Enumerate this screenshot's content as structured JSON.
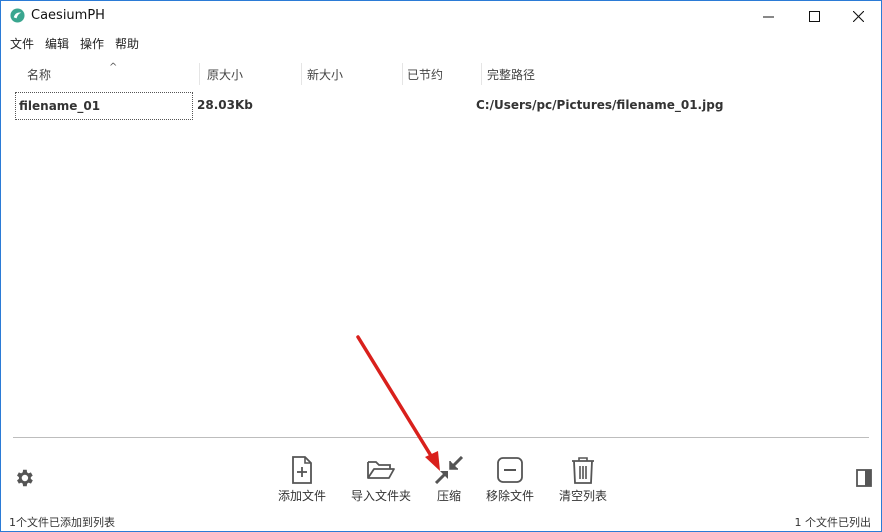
{
  "window": {
    "title": "CaesiumPH",
    "accent": "#2b7bd6"
  },
  "menu": [
    "文件",
    "编辑",
    "操作",
    "帮助"
  ],
  "table": {
    "columns": [
      "名称",
      "原大小",
      "新大小",
      "已节约",
      "完整路径"
    ],
    "rows": [
      {
        "name": "filename_01",
        "original_size": "28.03Kb",
        "new_size": "",
        "saved": "",
        "path": "C:/Users/pc/Pictures/filename_01.jpg"
      }
    ]
  },
  "toolbar": {
    "add_file": "添加文件",
    "import_folder": "导入文件夹",
    "compress": "压缩",
    "remove_file": "移除文件",
    "clear_list": "清空列表"
  },
  "status": {
    "left": "1个文件已添加到列表",
    "right": "1 个文件已列出"
  },
  "annotation": {
    "arrow_color": "#d9201c"
  }
}
